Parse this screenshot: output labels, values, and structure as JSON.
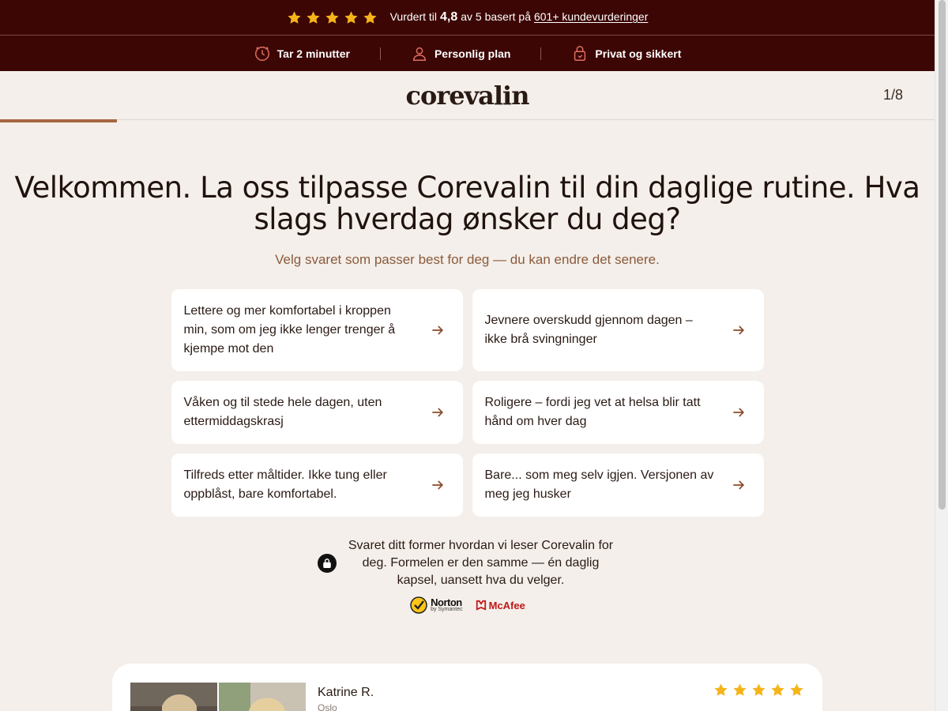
{
  "top_rating": {
    "prefix": "Vurdert til",
    "score": "4,8",
    "middle": "av 5 basert på",
    "link": "601+ kundevurderinger",
    "star_color": "#f5b41a"
  },
  "badges": [
    {
      "icon": "timer-icon",
      "label": "Tar 2 minutter"
    },
    {
      "icon": "user-icon",
      "label": "Personlig plan"
    },
    {
      "icon": "lock-bag-icon",
      "label": "Privat og sikkert"
    }
  ],
  "header": {
    "logo": "corevalin",
    "step": "1/8"
  },
  "progress": {
    "value": 0.125,
    "color": "#a56840"
  },
  "question": {
    "title": "Velkommen. La oss tilpasse Corevalin til din daglige rutine. Hva slags hverdag ønsker du deg?",
    "subtitle": "Velg svaret som passer best for deg — du kan endre det senere."
  },
  "options": [
    "Lettere og mer komfortabel i kroppen min, som om jeg ikke lenger trenger å kjempe mot den",
    "Jevnere overskudd gjennom dagen – ikke brå svingninger",
    "Våken og til stede hele dagen, uten ettermiddagskrasj",
    "Roligere – fordi jeg vet at helsa blir tatt hånd om hver dag",
    "Tilfreds etter måltider. Ikke tung eller oppblåst, bare komfortabel.",
    "Bare... som meg selv igjen. Versjonen av meg jeg husker"
  ],
  "privacy": {
    "text": "Svaret ditt former hvordan vi leser Corevalin for deg. Formelen er den samme — én daglig kapsel, uansett hva du velger."
  },
  "trust": {
    "norton": "Norton",
    "norton_sub": "by Symantec",
    "mcafee": "McAfee"
  },
  "review": {
    "name": "Katrine R.",
    "city": "Oslo",
    "stars": 5
  },
  "colors": {
    "brand_dark": "#3c0605",
    "background": "#f4efea",
    "accent": "#a56840"
  }
}
